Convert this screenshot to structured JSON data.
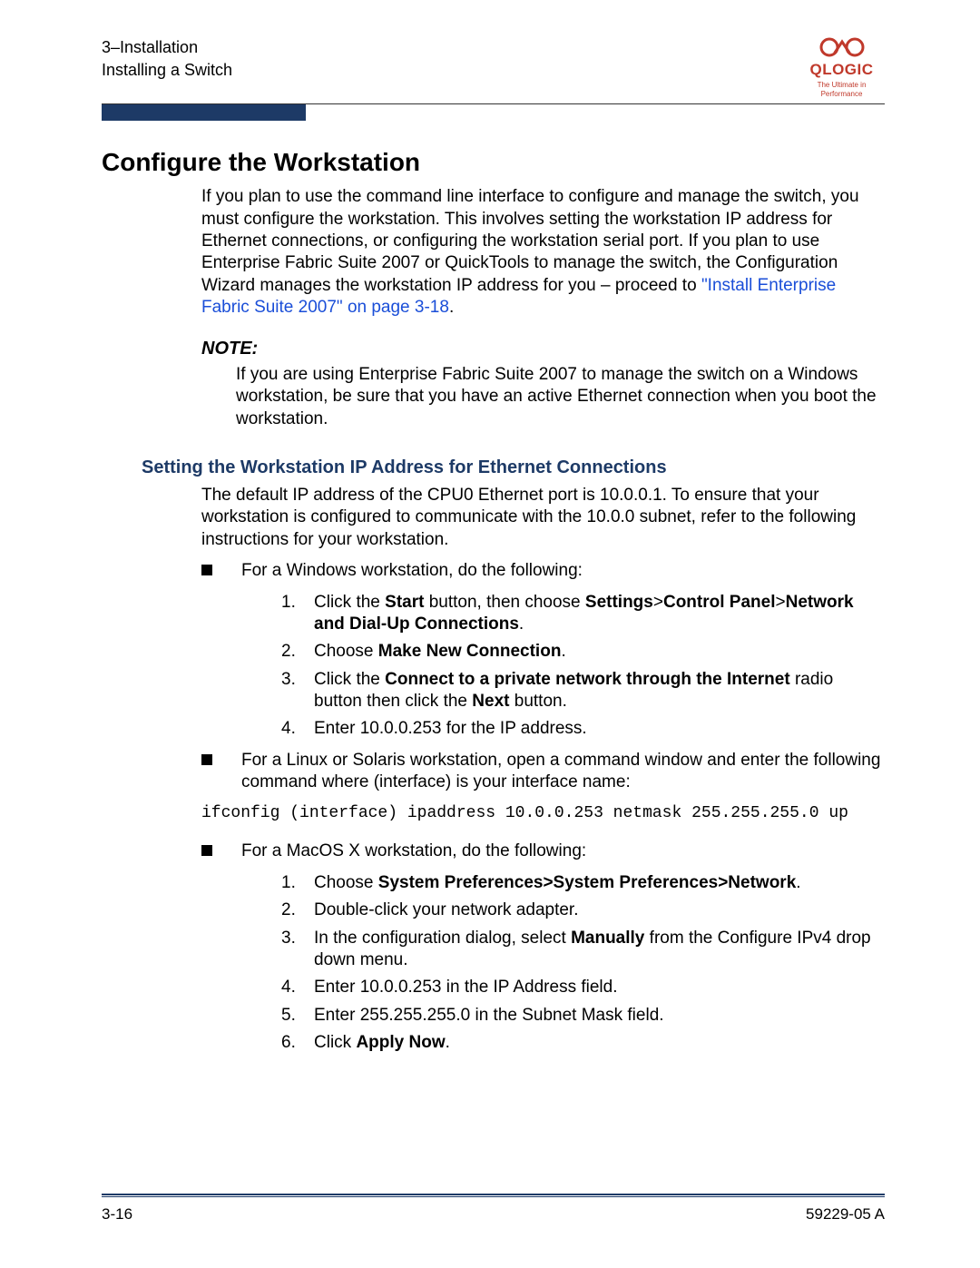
{
  "header": {
    "line1": "3–Installation",
    "line2": "Installing a Switch"
  },
  "brand": {
    "name": "QLOGIC",
    "tagline": "The Ultimate in Performance"
  },
  "title": "Configure the Workstation",
  "intro_part1": "If you plan to use the command line interface to configure and manage the switch, you must configure the workstation. This involves setting the workstation IP address for Ethernet connections, or configuring the workstation serial port. If you plan to use Enterprise Fabric Suite 2007 or QuickTools to manage the switch, the Configuration Wizard manages the workstation IP address for you – proceed to ",
  "intro_link": "\"Install Enterprise Fabric Suite 2007\" on page 3-18",
  "intro_part2": ".",
  "note_label": "NOTE:",
  "note_body": "If you are using Enterprise Fabric Suite 2007 to manage the switch on a Windows workstation, be sure that you have an active Ethernet connection when you boot the workstation.",
  "subheading": "Setting the Workstation IP Address for Ethernet Connections",
  "sub_intro": "The default IP address of the CPU0 Ethernet port is 10.0.0.1. To ensure that your workstation is configured to communicate with the 10.0.0 subnet, refer to the following instructions for your workstation.",
  "bullets": {
    "windows_lead": "For a Windows workstation, do the following:",
    "windows_steps": {
      "s1a": "Click the ",
      "s1b": "Start",
      "s1c": " button, then choose ",
      "s1d": "Settings",
      "s1e": ">",
      "s1f": "Control Panel",
      "s1g": ">",
      "s1h": "Network and Dial-Up Connections",
      "s1i": ".",
      "s2a": "Choose ",
      "s2b": "Make New Connection",
      "s2c": ".",
      "s3a": "Click the ",
      "s3b": "Connect to a private network through the Internet",
      "s3c": " radio button then click the ",
      "s3d": "Next",
      "s3e": " button.",
      "s4": "Enter 10.0.0.253 for the IP address."
    },
    "linux_lead": "For a Linux or Solaris workstation, open a command window and enter the following command where (interface) is your interface name:",
    "command": "ifconfig (interface) ipaddress 10.0.0.253 netmask 255.255.255.0 up",
    "mac_lead": "For a MacOS X workstation, do the following:",
    "mac_steps": {
      "m1a": "Choose ",
      "m1b": "System Preferences>System Preferences>Network",
      "m1c": ".",
      "m2": "Double-click your network adapter.",
      "m3a": "In the configuration dialog, select ",
      "m3b": "Manually",
      "m3c": " from the Configure IPv4 drop down menu.",
      "m4": "Enter 10.0.0.253 in the IP Address field.",
      "m5": "Enter 255.255.255.0 in the Subnet Mask field.",
      "m6a": "Click ",
      "m6b": "Apply Now",
      "m6c": "."
    }
  },
  "footer": {
    "left": "3-16",
    "right": "59229-05  A"
  }
}
